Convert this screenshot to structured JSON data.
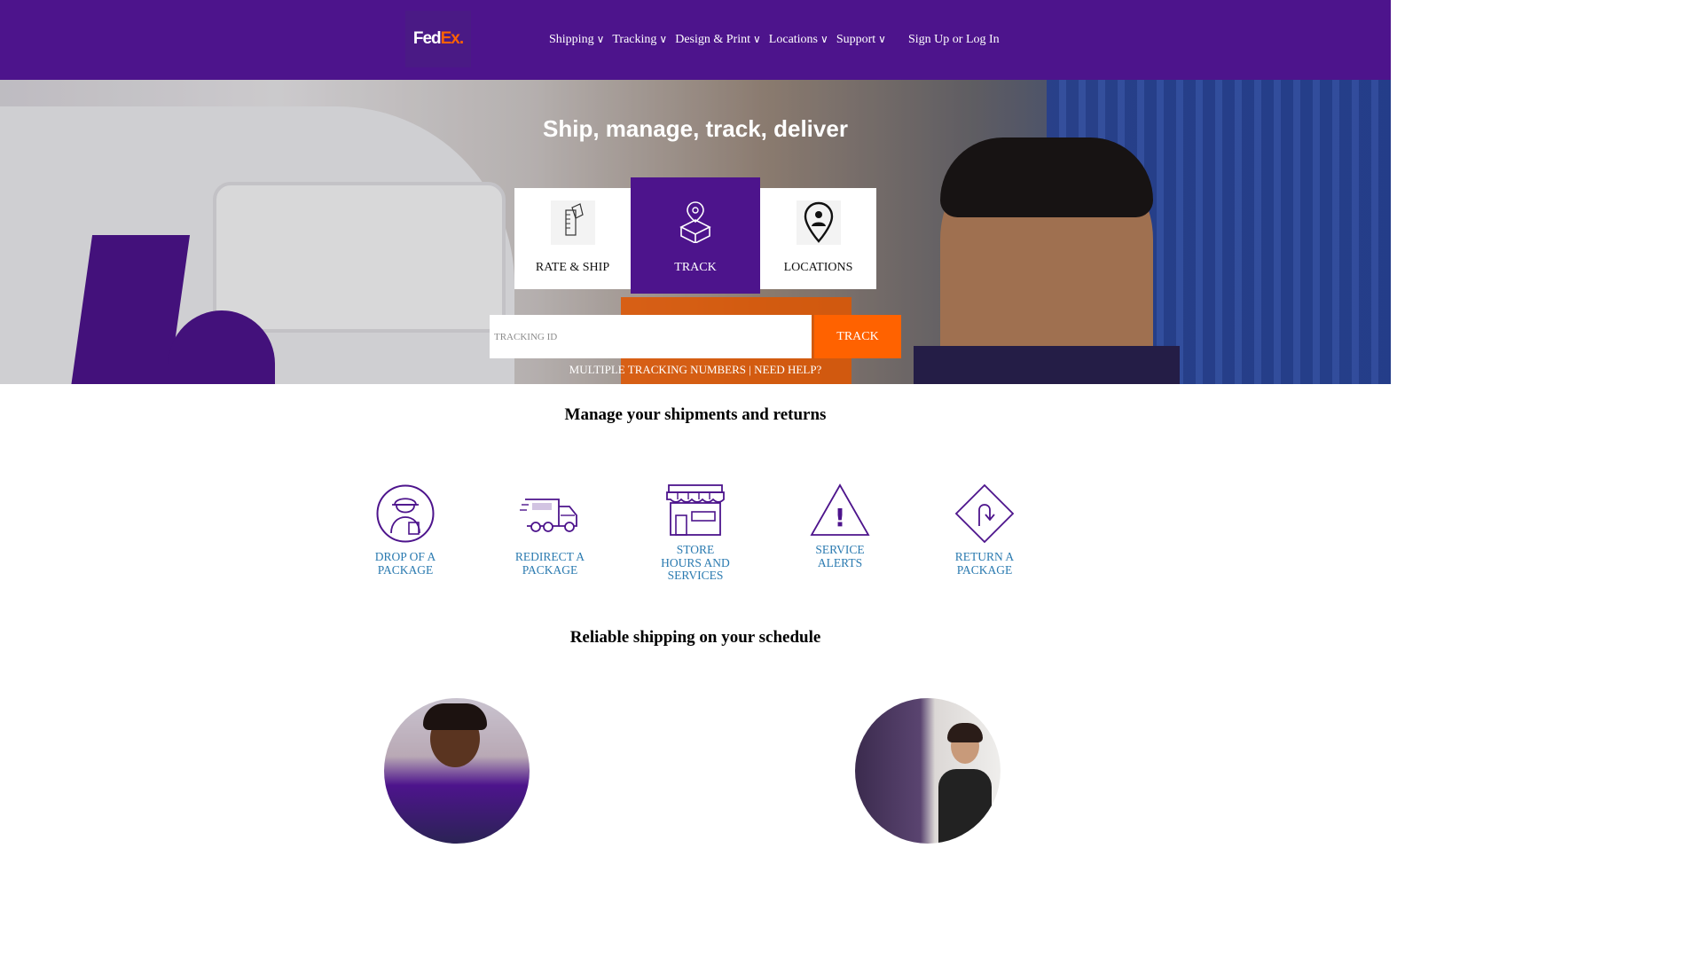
{
  "header": {
    "logo": {
      "part1": "Fed",
      "part2": "Ex",
      "suffix": "."
    },
    "nav": [
      {
        "label": "Shipping",
        "chevron": "∨"
      },
      {
        "label": "Tracking",
        "chevron": "∨"
      },
      {
        "label": "Design & Print",
        "chevron": "∨"
      },
      {
        "label": "Locations",
        "chevron": "∨"
      },
      {
        "label": "Support",
        "chevron": "∨"
      }
    ],
    "sign_in": "Sign Up or Log In"
  },
  "hero": {
    "title": "Ship, manage, track, deliver",
    "cards": [
      {
        "label": "RATE & SHIP",
        "icon": "box-ruler-icon"
      },
      {
        "label": "TRACK",
        "icon": "box-location-icon",
        "active": true
      },
      {
        "label": "LOCATIONS",
        "icon": "map-pin-icon"
      }
    ],
    "tracking": {
      "placeholder": "TRACKING ID",
      "value": "",
      "button": "TRACK",
      "link_multiple": "MULTIPLE TRACKING NUMBERS",
      "separator": " | ",
      "link_help": "NEED HELP?"
    }
  },
  "manage": {
    "title": "Manage your shipments and returns",
    "links": [
      {
        "label": "DROP OF A PACKAGE",
        "icon": "courier-person-icon"
      },
      {
        "label": "REDIRECT A PACKAGE",
        "icon": "delivery-truck-icon"
      },
      {
        "label": "STORE HOURS AND SERVICES",
        "icon": "storefront-icon"
      },
      {
        "label": "SERVICE ALERTS",
        "icon": "warning-triangle-icon"
      },
      {
        "label": "RETURN A PACKAGE",
        "icon": "return-arrow-icon"
      }
    ]
  },
  "reliable": {
    "title": "Reliable shipping on your schedule"
  },
  "colors": {
    "brand_purple": "#4d148c",
    "brand_orange": "#ff6200",
    "link_blue": "#2a7ab0"
  }
}
